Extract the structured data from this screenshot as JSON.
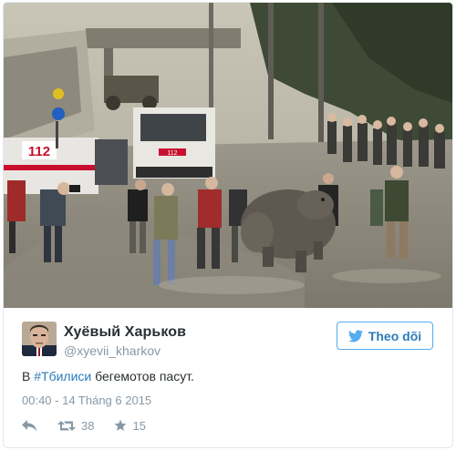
{
  "photo": {
    "truck_sign": "112",
    "van_sign": "112"
  },
  "tweet": {
    "display_name": "Хуёвый Харьков",
    "handle": "@xyevii_kharkov",
    "follow_label": "Theo dõi",
    "text_prefix": "В ",
    "hashtag": "#Тбилиси",
    "text_suffix": " бегемотов пасут.",
    "timestamp": "00:40 - 14 Tháng 6 2015",
    "retweet_count": "38",
    "like_count": "15"
  },
  "colors": {
    "link": "#2b7bb9",
    "twitter_blue": "#55acee",
    "muted": "#8899a6",
    "text": "#292f33",
    "border": "#e1e8ed"
  },
  "icons": {
    "follow": "twitter-bird-icon",
    "reply": "reply-arrow-icon",
    "retweet": "retweet-icon",
    "like": "star-icon"
  }
}
